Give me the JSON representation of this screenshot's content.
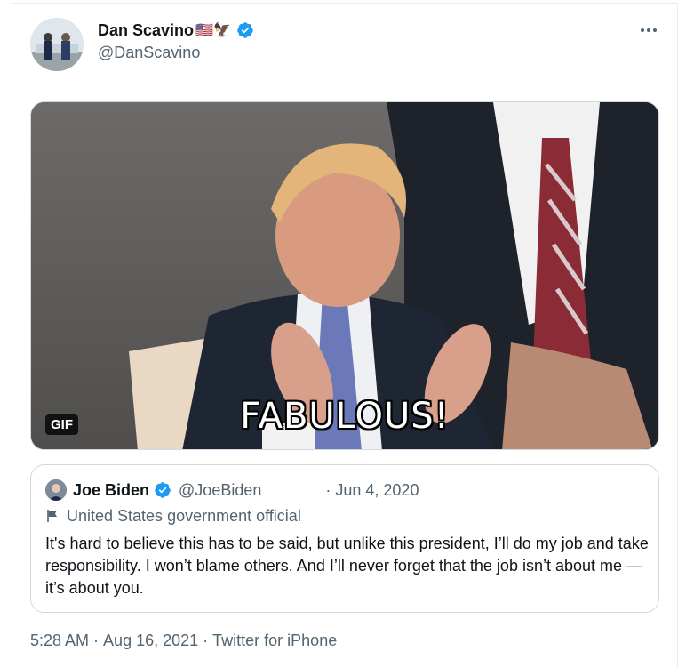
{
  "tweet": {
    "author_name": "Dan Scavino",
    "author_emoji": "🇺🇸🦅",
    "author_handle": "@DanScavino",
    "media": {
      "badge": "GIF",
      "caption": "FABULOUS!"
    },
    "quoted": {
      "author_name": "Joe Biden",
      "author_handle": "@JoeBiden",
      "date": "· Jun 4, 2020",
      "label": "United States government official",
      "text": "It's hard to believe this has to be said, but unlike this president, I’ll do my job and take responsibility. I won’t blame others. And I’ll never forget that the job isn’t about me — it’s about you."
    },
    "footer": {
      "time": "5:28 AM",
      "sep1": " · ",
      "date": "Aug 16, 2021",
      "sep2": " · ",
      "source": "Twitter for iPhone"
    }
  },
  "colors": {
    "verified": "#1d9bf0",
    "secondary_text": "#536471",
    "border": "#cfd9de"
  }
}
